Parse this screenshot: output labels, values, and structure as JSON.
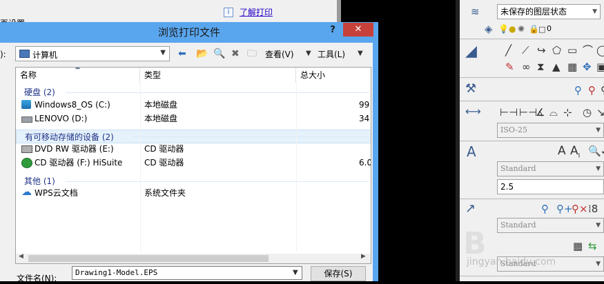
{
  "bg_dialog": {
    "settings_label": "页设置",
    "learn_link": "了解打印"
  },
  "browse": {
    "title": "浏览打印文件",
    "help": "?",
    "close": "✕",
    "lookin_label": "):",
    "lookin_value": "计算机",
    "view_label": "查看(V)",
    "tools_label": "工具(L)",
    "columns": [
      "名称",
      "类型",
      "总大小"
    ],
    "groups": [
      {
        "label": "硬盘 (2)"
      },
      {
        "label": "有可移动存储的设备 (2)"
      },
      {
        "label": "其他 (1)"
      }
    ],
    "rows": [
      {
        "name": "Windows8_OS (C:)",
        "type": "本地磁盘",
        "size": "99",
        "icon": "drive-os-icon"
      },
      {
        "name": "LENOVO (D:)",
        "type": "本地磁盘",
        "size": "34",
        "icon": "drive-icon"
      },
      {
        "name": "DVD RW 驱动器 (E:)",
        "type": "CD 驱动器",
        "size": "",
        "icon": "dvd-drive-icon"
      },
      {
        "name": "CD 驱动器 (F:) HiSuite",
        "type": "CD 驱动器",
        "size": "6.0",
        "icon": "cd-drive-icon"
      },
      {
        "name": "WPS云文档",
        "type": "系统文件夹",
        "size": "",
        "icon": "cloud-icon"
      }
    ],
    "filename_label": "文件名(N):",
    "filename_value": "Drawing1-Model.EPS",
    "save_label": "保存(S)"
  },
  "panel": {
    "layer_state": "未保存的图层状态",
    "layer_current": "0",
    "dim_style": "ISO-25",
    "text_style": "Standard",
    "text_height": "2.5",
    "mleader_style": "Standard",
    "table_style": "Standard"
  },
  "watermark": {
    "glyph": "B",
    "text": "jingyan.baidu.com"
  }
}
